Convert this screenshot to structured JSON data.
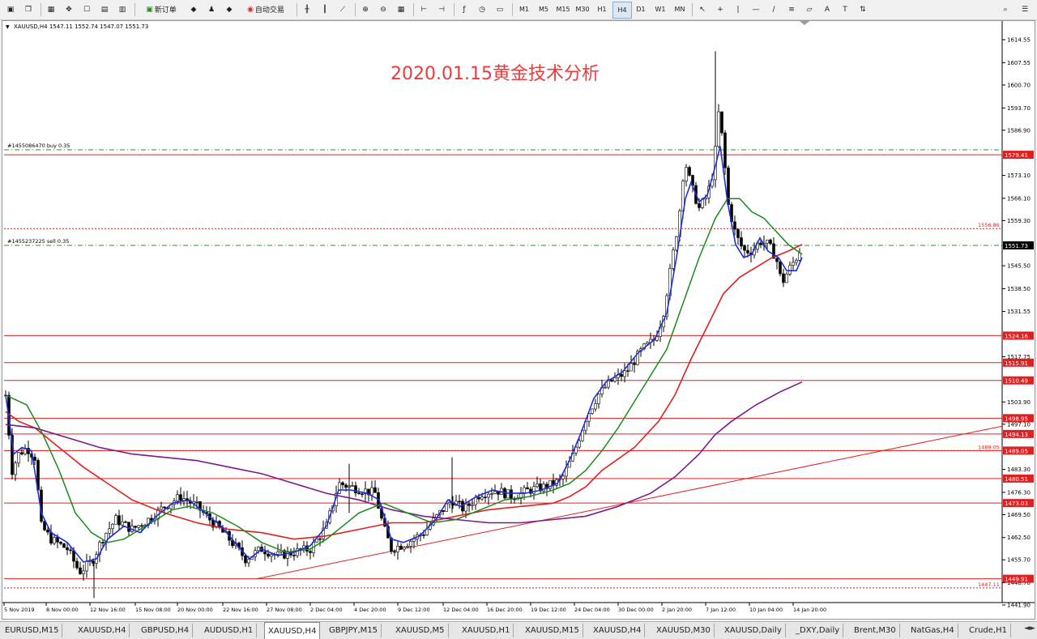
{
  "toolbar": {
    "new_order": "新订单",
    "auto_trade": "自动交易",
    "timeframes": [
      "M1",
      "M5",
      "M15",
      "M30",
      "H1",
      "H4",
      "D1",
      "W1",
      "MN"
    ],
    "active_timeframe": "H4",
    "icons": [
      "new-chart-icon",
      "profiles-icon",
      "market-watch-icon",
      "navigator-icon",
      "data-window-icon",
      "terminal-icon",
      "strategy-tester-icon",
      "new-order-icon",
      "metaeditor-icon",
      "fetch-icon",
      "auto-trading-icon",
      "bar-chart-icon",
      "candlestick-icon",
      "line-chart-icon",
      "zoom-in-icon",
      "zoom-out-icon",
      "tile-windows-icon",
      "chart-shift-icon",
      "autoscroll-icon",
      "indicators-icon",
      "periods-icon",
      "templates-icon",
      "cursor-icon",
      "crosshair-icon",
      "vertical-line-icon",
      "horizontal-line-icon",
      "trendline-icon",
      "fibonacci-icon",
      "equidistant-channel-icon",
      "text-icon",
      "text-label-icon",
      "arrows-icon",
      "search-icon",
      "chat-icon"
    ]
  },
  "chart": {
    "info": "XAUUSD,H4  1547.11 1552.74 1547.07 1551.73",
    "title": "2020.01.15黄金技术分析",
    "title_color": "#e83b3b",
    "order_buy": "#1455086470 buy 0.35",
    "order_sell": "#1455237225 sell 0.35",
    "current_price": "1551.73",
    "y_ticks": [
      "1614.55",
      "1607.55",
      "1600.70",
      "1593.70",
      "1586.90",
      "1573.10",
      "1566.10",
      "1559.30",
      "1545.50",
      "1538.50",
      "1531.55",
      "1517.75",
      "1503.90",
      "1497.10",
      "1483.30",
      "1476.30",
      "1469.50",
      "1462.50",
      "1455.70",
      "1448.70",
      "1441.90"
    ],
    "price_lines": [
      "1579.41",
      "1524.16",
      "1515.91",
      "1510.49",
      "1498.95",
      "1494.13",
      "1489.05",
      "1480.51",
      "1473.03",
      "1449.91"
    ],
    "dotted_levels": [
      "1556.86",
      "1489.05",
      "1447.11"
    ],
    "x_labels": [
      "5 Nov 2019",
      "8 Nov 00:00",
      "12 Nov 16:00",
      "15 Nov 08:00",
      "20 Nov 00:00",
      "22 Nov 16:00",
      "27 Nov 08:00",
      "2 Dec 04:00",
      "4 Dec 20:00",
      "9 Dec 12:00",
      "12 Dec 04:00",
      "16 Dec 20:00",
      "19 Dec 12:00",
      "24 Dec 04:00",
      "30 Dec 00:00",
      "2 Jan 20:00",
      "7 Jan 12:00",
      "10 Jan 04:00",
      "14 Jan 20:00"
    ],
    "colors": {
      "candles": "#000000",
      "ma_fast": "#1f2fd6",
      "ma_mid": "#1a8a1a",
      "ma_slow": "#e02020",
      "ma_long": "#7a1a8a",
      "levels": "#e02020",
      "orders": "#2e8b2e"
    }
  },
  "tabs": [
    "EURUSD,M15",
    "XAUUSD,H4",
    "GBPUSD,H4",
    "AUDUSD,H1",
    "XAUUSD,H4",
    "GBPJPY,M15",
    "XAUUSD,M5",
    "XAUUSD,H1",
    "XAUUSD,M15",
    "XAUUSD,H4",
    "XAUUSD,M30",
    "XAUUSD,Daily",
    "_DXY,Daily",
    "Brent,M30",
    "NatGas,H4",
    "Crude,H1"
  ],
  "active_tab_index": 4
}
